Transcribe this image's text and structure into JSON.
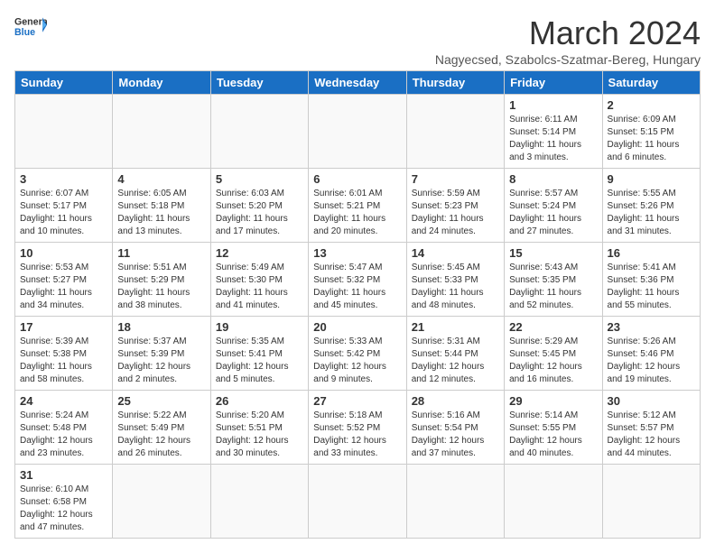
{
  "header": {
    "logo_general": "General",
    "logo_blue": "Blue",
    "title": "March 2024",
    "subtitle": "Nagyecsed, Szabolcs-Szatmar-Bereg, Hungary"
  },
  "weekdays": [
    "Sunday",
    "Monday",
    "Tuesday",
    "Wednesday",
    "Thursday",
    "Friday",
    "Saturday"
  ],
  "weeks": [
    [
      {
        "day": "",
        "info": ""
      },
      {
        "day": "",
        "info": ""
      },
      {
        "day": "",
        "info": ""
      },
      {
        "day": "",
        "info": ""
      },
      {
        "day": "",
        "info": ""
      },
      {
        "day": "1",
        "info": "Sunrise: 6:11 AM\nSunset: 5:14 PM\nDaylight: 11 hours\nand 3 minutes."
      },
      {
        "day": "2",
        "info": "Sunrise: 6:09 AM\nSunset: 5:15 PM\nDaylight: 11 hours\nand 6 minutes."
      }
    ],
    [
      {
        "day": "3",
        "info": "Sunrise: 6:07 AM\nSunset: 5:17 PM\nDaylight: 11 hours\nand 10 minutes."
      },
      {
        "day": "4",
        "info": "Sunrise: 6:05 AM\nSunset: 5:18 PM\nDaylight: 11 hours\nand 13 minutes."
      },
      {
        "day": "5",
        "info": "Sunrise: 6:03 AM\nSunset: 5:20 PM\nDaylight: 11 hours\nand 17 minutes."
      },
      {
        "day": "6",
        "info": "Sunrise: 6:01 AM\nSunset: 5:21 PM\nDaylight: 11 hours\nand 20 minutes."
      },
      {
        "day": "7",
        "info": "Sunrise: 5:59 AM\nSunset: 5:23 PM\nDaylight: 11 hours\nand 24 minutes."
      },
      {
        "day": "8",
        "info": "Sunrise: 5:57 AM\nSunset: 5:24 PM\nDaylight: 11 hours\nand 27 minutes."
      },
      {
        "day": "9",
        "info": "Sunrise: 5:55 AM\nSunset: 5:26 PM\nDaylight: 11 hours\nand 31 minutes."
      }
    ],
    [
      {
        "day": "10",
        "info": "Sunrise: 5:53 AM\nSunset: 5:27 PM\nDaylight: 11 hours\nand 34 minutes."
      },
      {
        "day": "11",
        "info": "Sunrise: 5:51 AM\nSunset: 5:29 PM\nDaylight: 11 hours\nand 38 minutes."
      },
      {
        "day": "12",
        "info": "Sunrise: 5:49 AM\nSunset: 5:30 PM\nDaylight: 11 hours\nand 41 minutes."
      },
      {
        "day": "13",
        "info": "Sunrise: 5:47 AM\nSunset: 5:32 PM\nDaylight: 11 hours\nand 45 minutes."
      },
      {
        "day": "14",
        "info": "Sunrise: 5:45 AM\nSunset: 5:33 PM\nDaylight: 11 hours\nand 48 minutes."
      },
      {
        "day": "15",
        "info": "Sunrise: 5:43 AM\nSunset: 5:35 PM\nDaylight: 11 hours\nand 52 minutes."
      },
      {
        "day": "16",
        "info": "Sunrise: 5:41 AM\nSunset: 5:36 PM\nDaylight: 11 hours\nand 55 minutes."
      }
    ],
    [
      {
        "day": "17",
        "info": "Sunrise: 5:39 AM\nSunset: 5:38 PM\nDaylight: 11 hours\nand 58 minutes."
      },
      {
        "day": "18",
        "info": "Sunrise: 5:37 AM\nSunset: 5:39 PM\nDaylight: 12 hours\nand 2 minutes."
      },
      {
        "day": "19",
        "info": "Sunrise: 5:35 AM\nSunset: 5:41 PM\nDaylight: 12 hours\nand 5 minutes."
      },
      {
        "day": "20",
        "info": "Sunrise: 5:33 AM\nSunset: 5:42 PM\nDaylight: 12 hours\nand 9 minutes."
      },
      {
        "day": "21",
        "info": "Sunrise: 5:31 AM\nSunset: 5:44 PM\nDaylight: 12 hours\nand 12 minutes."
      },
      {
        "day": "22",
        "info": "Sunrise: 5:29 AM\nSunset: 5:45 PM\nDaylight: 12 hours\nand 16 minutes."
      },
      {
        "day": "23",
        "info": "Sunrise: 5:26 AM\nSunset: 5:46 PM\nDaylight: 12 hours\nand 19 minutes."
      }
    ],
    [
      {
        "day": "24",
        "info": "Sunrise: 5:24 AM\nSunset: 5:48 PM\nDaylight: 12 hours\nand 23 minutes."
      },
      {
        "day": "25",
        "info": "Sunrise: 5:22 AM\nSunset: 5:49 PM\nDaylight: 12 hours\nand 26 minutes."
      },
      {
        "day": "26",
        "info": "Sunrise: 5:20 AM\nSunset: 5:51 PM\nDaylight: 12 hours\nand 30 minutes."
      },
      {
        "day": "27",
        "info": "Sunrise: 5:18 AM\nSunset: 5:52 PM\nDaylight: 12 hours\nand 33 minutes."
      },
      {
        "day": "28",
        "info": "Sunrise: 5:16 AM\nSunset: 5:54 PM\nDaylight: 12 hours\nand 37 minutes."
      },
      {
        "day": "29",
        "info": "Sunrise: 5:14 AM\nSunset: 5:55 PM\nDaylight: 12 hours\nand 40 minutes."
      },
      {
        "day": "30",
        "info": "Sunrise: 5:12 AM\nSunset: 5:57 PM\nDaylight: 12 hours\nand 44 minutes."
      }
    ],
    [
      {
        "day": "31",
        "info": "Sunrise: 6:10 AM\nSunset: 6:58 PM\nDaylight: 12 hours\nand 47 minutes."
      },
      {
        "day": "",
        "info": ""
      },
      {
        "day": "",
        "info": ""
      },
      {
        "day": "",
        "info": ""
      },
      {
        "day": "",
        "info": ""
      },
      {
        "day": "",
        "info": ""
      },
      {
        "day": "",
        "info": ""
      }
    ]
  ]
}
